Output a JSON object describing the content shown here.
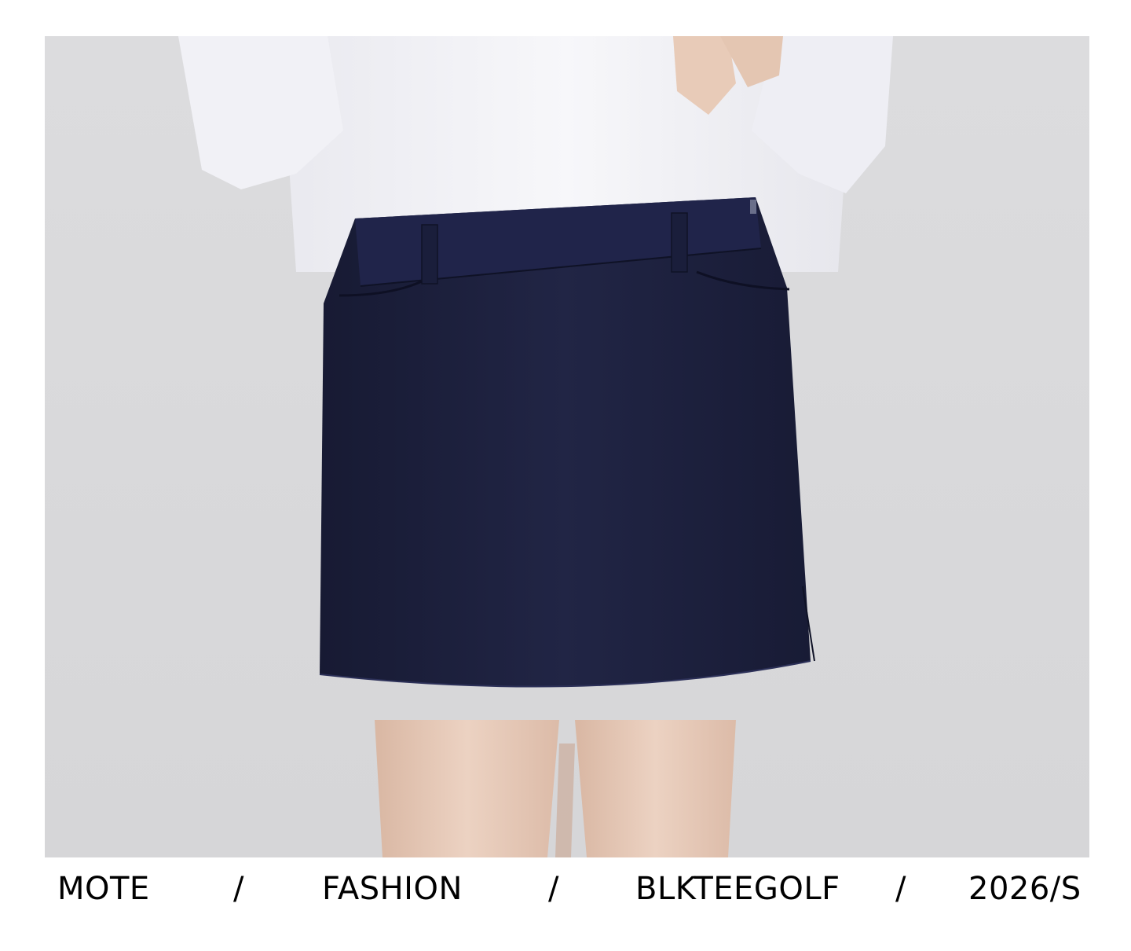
{
  "caption": {
    "items": [
      "MOTE",
      "FASHION",
      "BLKTEEGOLF",
      "2026/S"
    ],
    "separator": "/"
  },
  "colors": {
    "background": "#d9d9db",
    "skirt": "#1d2140",
    "shirt": "#f4f4f7",
    "skin": "#e8cbb8",
    "text": "#000000"
  }
}
